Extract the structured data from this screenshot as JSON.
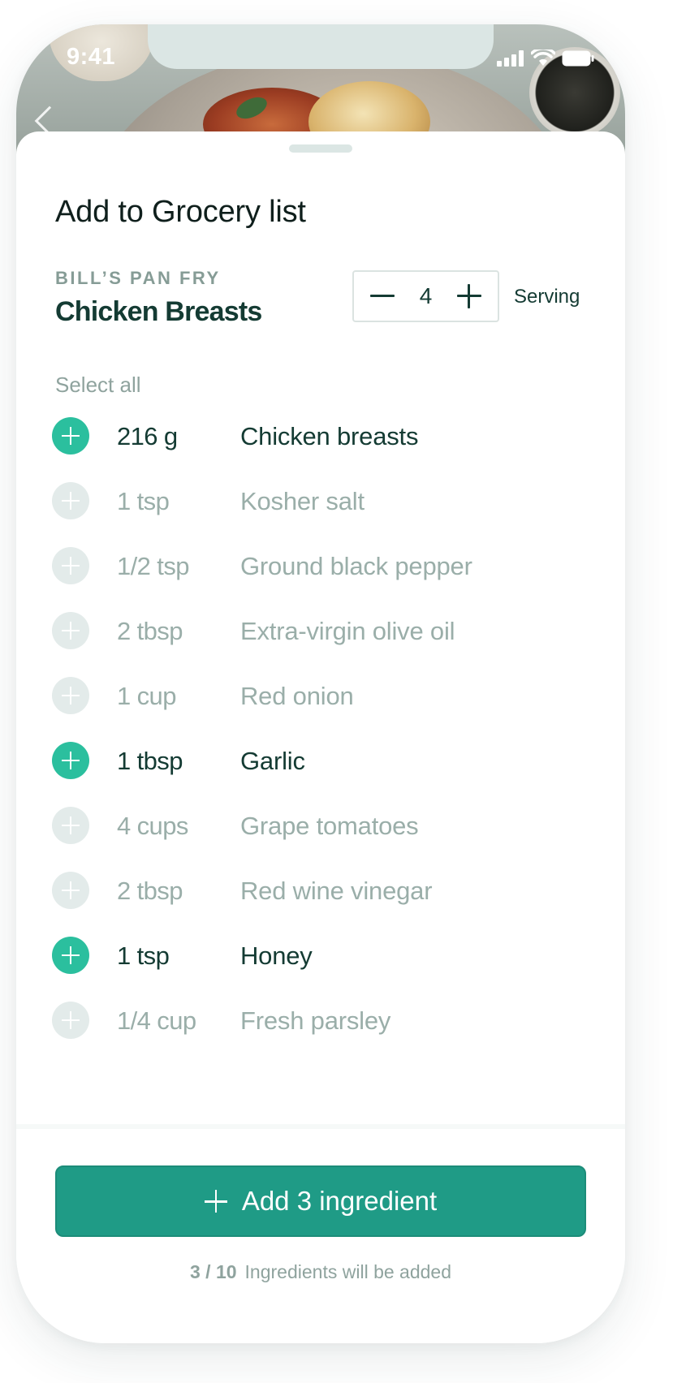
{
  "status_bar": {
    "time": "9:41"
  },
  "sheet": {
    "title": "Add to Grocery list",
    "recipe_source": "BILL’S PAN FRY",
    "recipe_name": "Chicken Breasts",
    "servings": {
      "value": "4",
      "label": "Serving"
    },
    "select_all_label": "Select all",
    "ingredients": [
      {
        "amount": "216 g",
        "name": "Chicken breasts",
        "selected": true
      },
      {
        "amount": "1 tsp",
        "name": "Kosher salt",
        "selected": false
      },
      {
        "amount": "1/2 tsp",
        "name": "Ground black pepper",
        "selected": false
      },
      {
        "amount": "2 tbsp",
        "name": "Extra-virgin olive oil",
        "selected": false
      },
      {
        "amount": "1 cup",
        "name": "Red onion",
        "selected": false
      },
      {
        "amount": "1 tbsp",
        "name": "Garlic",
        "selected": true
      },
      {
        "amount": "4 cups",
        "name": "Grape tomatoes",
        "selected": false
      },
      {
        "amount": "2 tbsp",
        "name": "Red wine vinegar",
        "selected": false
      },
      {
        "amount": "1 tsp",
        "name": "Honey",
        "selected": true
      },
      {
        "amount": "1/4 cup",
        "name": "Fresh parsley",
        "selected": false
      }
    ],
    "cta": {
      "label": "Add 3 ingredient",
      "caption_count": "3 / 10",
      "caption_text": "Ingredients will be added"
    }
  },
  "colors": {
    "accent": "#2bbf9e",
    "button": "#1f9b86",
    "text_dark": "#143b33",
    "text_muted": "#9aaea9"
  },
  "icons": [
    "back-icon",
    "signal-icon",
    "wifi-icon",
    "battery-icon",
    "minus-icon",
    "plus-icon",
    "add-circle-icon"
  ]
}
